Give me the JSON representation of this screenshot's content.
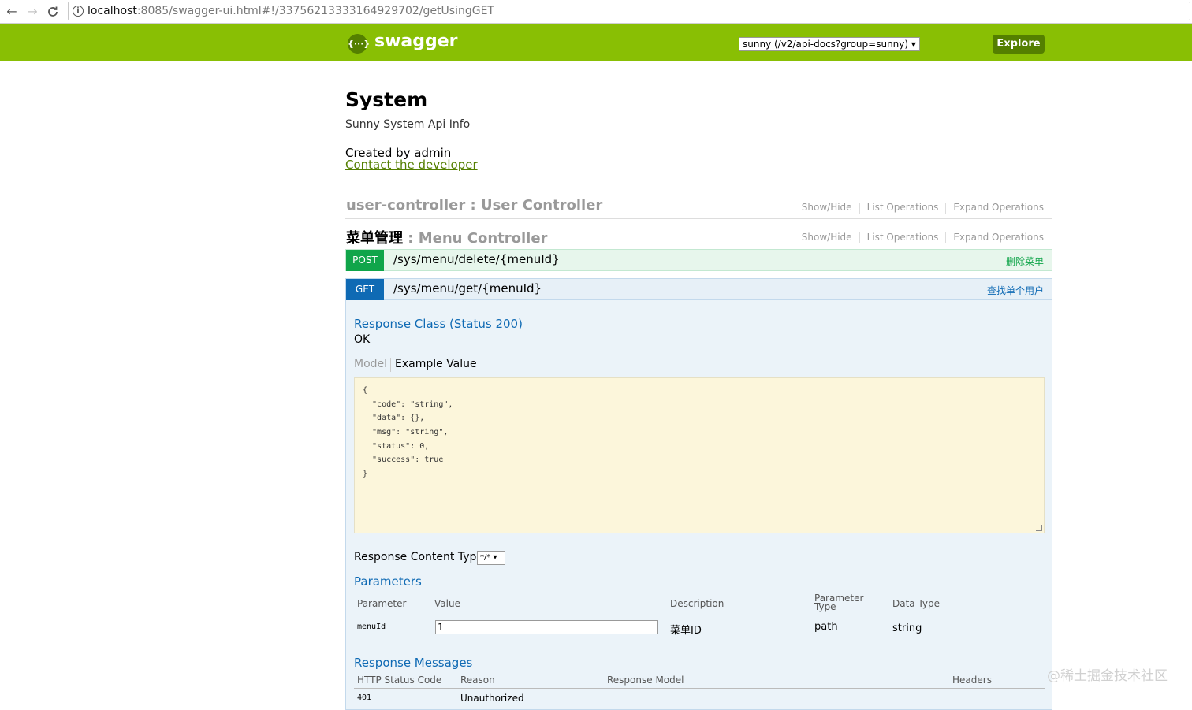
{
  "browser": {
    "back_glyph": "←",
    "forward_glyph": "→",
    "reload_glyph": "C",
    "info_glyph": "i",
    "url_host": "localhost",
    "url_rest": ":8085/swagger-ui.html#!/3375621333316492970​2/getUsingGET"
  },
  "header": {
    "logo_glyph": "{···}",
    "logo_text": "swagger",
    "api_select_value": "sunny (/v2/api-docs?group=sunny) ▾",
    "explore_label": "Explore",
    "brand_color": "#89bf04"
  },
  "info": {
    "title": "System",
    "description": "Sunny System Api Info",
    "created_by": "Created by admin",
    "contact_link": "Contact the developer"
  },
  "resources": [
    {
      "name_en": "user-controller",
      "name_sep": " : ",
      "controller": "User Controller"
    },
    {
      "name_cn": "菜单管理",
      "name_sep": " : ",
      "controller": "Menu Controller"
    }
  ],
  "resource_ops": {
    "show_hide": "Show/Hide",
    "list_ops": "List Operations",
    "expand_ops": "Expand Operations"
  },
  "operations": {
    "post": {
      "method": "POST",
      "path": "/sys/menu/delete/{menuId}",
      "summary": "删除菜单"
    },
    "get": {
      "method": "GET",
      "path": "/sys/menu/get/{menuId}",
      "summary": "查找单个用户"
    }
  },
  "get_detail": {
    "response_class_title": "Response Class (Status 200)",
    "response_class_value": "OK",
    "tab_model": "Model",
    "tab_example": "Example Value",
    "example_lines": [
      "{",
      "  \"code\": \"string\",",
      "  \"data\": {},",
      "  \"msg\": \"string\",",
      "  \"status\": 0,",
      "  \"success\": true",
      "}"
    ],
    "response_content_type_label": "Response Content Type",
    "response_content_type_value": "*/* ▾",
    "parameters_title": "Parameters",
    "param_headers": {
      "parameter": "Parameter",
      "value": "Value",
      "description": "Description",
      "param_type": "Parameter Type",
      "data_type": "Data Type"
    },
    "params": [
      {
        "name": "menuId",
        "value": "1",
        "description": "菜单ID",
        "param_type": "path",
        "data_type": "string"
      }
    ],
    "response_messages_title": "Response Messages",
    "msg_headers": {
      "status_code": "HTTP Status Code",
      "reason": "Reason",
      "model": "Response Model",
      "headers": "Headers"
    },
    "messages": [
      {
        "code": "401",
        "reason": "Unauthorized"
      }
    ]
  },
  "watermark": "@稀土掘金技术社区"
}
